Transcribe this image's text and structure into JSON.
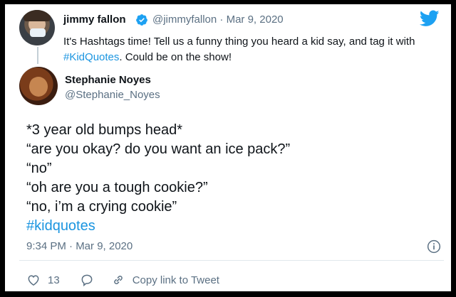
{
  "original_tweet": {
    "author_name": "jimmy fallon",
    "handle": "@jimmyfallon",
    "separator": "·",
    "date": "Mar 9, 2020",
    "text_before": "It's Hashtags time! Tell us a funny thing you heard a kid say, and tag it with ",
    "hashtag": "#KidQuotes",
    "text_after": ". Could be on the show!"
  },
  "reply": {
    "author_name": "Stephanie Noyes",
    "handle": "@Stephanie_Noyes",
    "lines": [
      "*3 year old bumps head*",
      "“are you okay? do you want an ice pack?”",
      "“no”",
      "“oh are you a tough cookie?”",
      "“no, i’m a crying cookie”"
    ],
    "hashtag": "#kidquotes",
    "timestamp": "9:34 PM · Mar 9, 2020"
  },
  "actions": {
    "like_count": "13",
    "copy_link_label": "Copy link to Tweet"
  },
  "colors": {
    "link": "#1b95e0",
    "text": "#0f1419",
    "secondary": "#5b7083",
    "verified": "#1da1f2"
  },
  "icons": [
    "twitter-bird-icon",
    "verified-badge-icon",
    "info-icon",
    "heart-icon",
    "reply-bubble-icon",
    "link-icon"
  ]
}
